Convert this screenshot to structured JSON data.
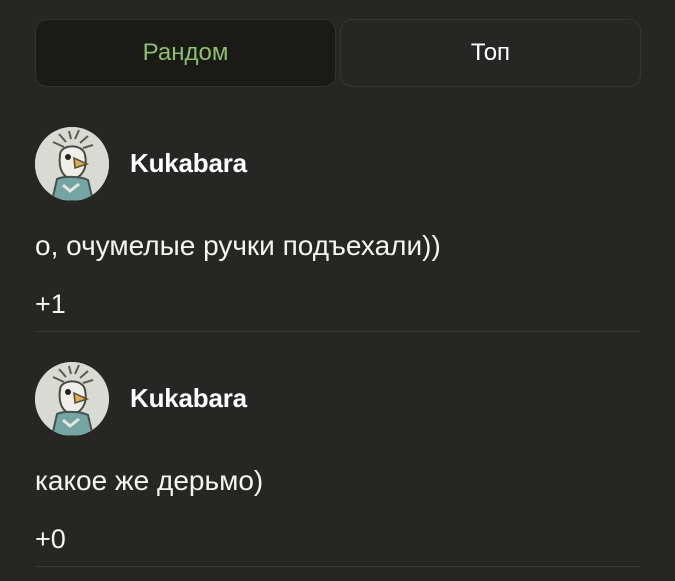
{
  "tabs": {
    "random_label": "Рандом",
    "top_label": "Топ",
    "active": "random"
  },
  "comments": [
    {
      "username": "Kukabara",
      "text": "о, очумелые ручки подъехали))",
      "score": "+1",
      "avatar_icon": "rooster-avatar-icon"
    },
    {
      "username": "Kukabara",
      "text": "какое же дерьмо)",
      "score": "+0",
      "avatar_icon": "rooster-avatar-icon"
    }
  ],
  "colors": {
    "background": "#262724",
    "active_tab_bg": "#1a1b17",
    "active_tab_text": "#8fbe6d",
    "text": "#f4f4f2",
    "divider": "#3b3d37"
  }
}
